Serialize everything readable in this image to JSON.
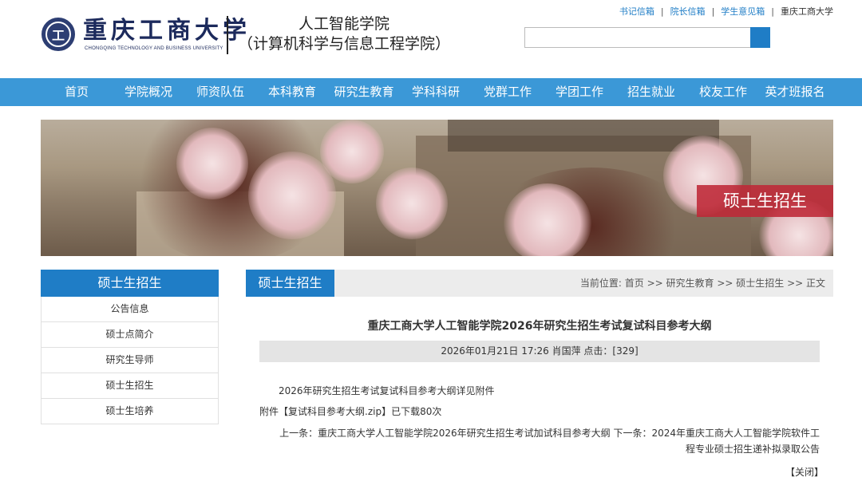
{
  "header": {
    "logo_seal_char": "工",
    "logo_cn": "重庆工商大学",
    "logo_en": "CHONGQING TECHNOLOGY AND BUSINESS UNIVERSITY",
    "college_line1": "人工智能学院",
    "college_line2": "（计算机科学与信息工程学院）",
    "top_links": [
      "书记信箱",
      "院长信箱",
      "学生意见箱"
    ],
    "top_plain": "重庆工商大学",
    "search_placeholder": ""
  },
  "nav": {
    "items": [
      "首页",
      "学院概况",
      "师资队伍",
      "本科教育",
      "研究生教育",
      "学科科研",
      "党群工作",
      "学团工作",
      "招生就业",
      "校友工作",
      "英才班报名"
    ]
  },
  "banner": {
    "label": "硕士生招生"
  },
  "sidebar": {
    "title": "硕士生招生",
    "items": [
      "公告信息",
      "硕士点简介",
      "研究生导师",
      "硕士生招生",
      "硕士生培养"
    ]
  },
  "main": {
    "tab": "硕士生招生",
    "breadcrumb": "当前位置: 首页 >> 研究生教育 >> 硕士生招生 >> 正文",
    "title": "重庆工商大学人工智能学院2026年研究生招生考试复试科目参考大纲",
    "meta": "2026年01月21日 17:26 肖国萍 点击：[329]",
    "content": "2026年研究生招生考试复试科目参考大纲详见附件",
    "attach_prefix": "附件【",
    "attach_name": "复试科目参考大纲.zip",
    "attach_suffix": "】已下载80次",
    "prev": "上一条：重庆工商大学人工智能学院2026年研究生招生考试加试科目参考大纲",
    "next": "下一条：2024年重庆工商大人工智能学院软件工程专业硕士招生递补拟录取公告",
    "close": "【关闭】"
  }
}
